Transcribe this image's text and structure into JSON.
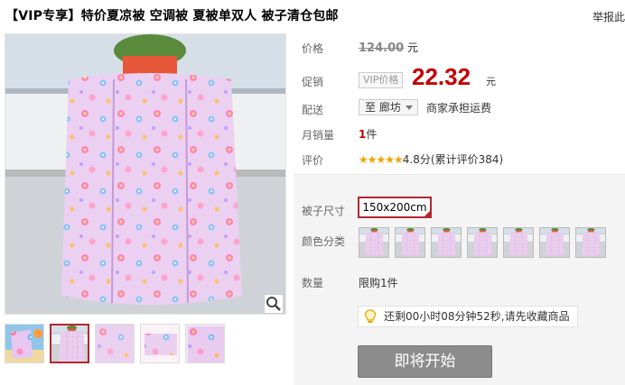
{
  "product": {
    "title": "【VIP专享】特价夏凉被 空调被 夏被单双人 被子清仓包邮"
  },
  "header": {
    "report_label": "举报此"
  },
  "labels": {
    "price": "价格",
    "promo": "促销",
    "delivery": "配送",
    "monthly_sales": "月销量",
    "rating": "评价",
    "size": "被子尺寸",
    "color": "颜色分类",
    "quantity": "数量"
  },
  "price": {
    "original": "124.00",
    "unit": "元"
  },
  "promo": {
    "tag": "VIP价格",
    "value": "22.32",
    "unit": "元"
  },
  "delivery": {
    "region": "至 廊坊",
    "shipping": "商家承担运费"
  },
  "sales": {
    "count": "1",
    "unit": "件"
  },
  "rating": {
    "stars": "★★★★★",
    "score": "4.8分",
    "reviews": "(累计评价384)"
  },
  "sku": {
    "size_selected": "150x200cm",
    "color_option_count": 7
  },
  "quantity": {
    "limit": "限购1件"
  },
  "countdown": {
    "text": "还剩00小时08分钟52秒,请先收藏商品"
  },
  "buttons": {
    "start": "即将开始"
  },
  "colors": {
    "accent_red": "#c40000",
    "selected_border": "#b4262f",
    "star_gold": "#f2a200",
    "disabled_button": "#8c8c8c"
  }
}
